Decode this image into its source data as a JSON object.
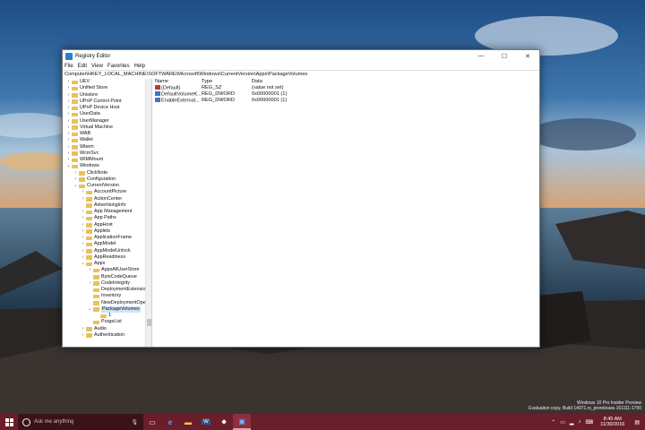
{
  "window": {
    "title": "Registry Editor",
    "minimize": "—",
    "maximize": "☐",
    "close": "✕"
  },
  "menu": [
    "File",
    "Edit",
    "View",
    "Favorites",
    "Help"
  ],
  "address": "Computer\\HKEY_LOCAL_MACHINE\\SOFTWARE\\Microsoft\\Windows\\CurrentVersion\\Appx\\PackageVolumes",
  "tree": [
    {
      "label": "UEV",
      "depth": 0,
      "chevron": ">"
    },
    {
      "label": "Unified Store",
      "depth": 0,
      "chevron": ">"
    },
    {
      "label": "Unistore",
      "depth": 0,
      "chevron": ">"
    },
    {
      "label": "UPnP Control Point",
      "depth": 0,
      "chevron": ">"
    },
    {
      "label": "UPnP Device Host",
      "depth": 0,
      "chevron": ">"
    },
    {
      "label": "UserData",
      "depth": 0,
      "chevron": ">"
    },
    {
      "label": "UserManager",
      "depth": 0,
      "chevron": ">"
    },
    {
      "label": "Virtual Machine",
      "depth": 0,
      "chevron": ">"
    },
    {
      "label": "WAB",
      "depth": 0,
      "chevron": ">"
    },
    {
      "label": "Wallet",
      "depth": 0,
      "chevron": ">"
    },
    {
      "label": "Wbem",
      "depth": 0,
      "chevron": ">"
    },
    {
      "label": "WcmSvc",
      "depth": 0,
      "chevron": ">"
    },
    {
      "label": "WIMMount",
      "depth": 0,
      "chevron": ">"
    },
    {
      "label": "Windows",
      "depth": 0,
      "chevron": "v"
    },
    {
      "label": "ClickNote",
      "depth": 1,
      "chevron": ">"
    },
    {
      "label": "Configuration",
      "depth": 1,
      "chevron": ">"
    },
    {
      "label": "CurrentVersion",
      "depth": 1,
      "chevron": "v"
    },
    {
      "label": "AccountPicture",
      "depth": 2,
      "chevron": ">"
    },
    {
      "label": "ActionCenter",
      "depth": 2,
      "chevron": ">"
    },
    {
      "label": "AdvertisingInfo",
      "depth": 2,
      "chevron": ""
    },
    {
      "label": "App Management",
      "depth": 2,
      "chevron": ">"
    },
    {
      "label": "App Paths",
      "depth": 2,
      "chevron": ">"
    },
    {
      "label": "AppHost",
      "depth": 2,
      "chevron": ">"
    },
    {
      "label": "Applets",
      "depth": 2,
      "chevron": ">"
    },
    {
      "label": "ApplicationFrame",
      "depth": 2,
      "chevron": ">"
    },
    {
      "label": "AppModel",
      "depth": 2,
      "chevron": ">"
    },
    {
      "label": "AppModelUnlock",
      "depth": 2,
      "chevron": ">"
    },
    {
      "label": "AppReadiness",
      "depth": 2,
      "chevron": ">"
    },
    {
      "label": "Appx",
      "depth": 2,
      "chevron": "v"
    },
    {
      "label": "AppxAllUserStore",
      "depth": 3,
      "chevron": ">"
    },
    {
      "label": "ByteCodeQueue",
      "depth": 3,
      "chevron": ""
    },
    {
      "label": "CodeIntegrity",
      "depth": 3,
      "chevron": ">"
    },
    {
      "label": "DeploymentExtensio",
      "depth": 3,
      "chevron": ""
    },
    {
      "label": "Inventory",
      "depth": 3,
      "chevron": ""
    },
    {
      "label": "NewDeploymentOpe",
      "depth": 3,
      "chevron": ""
    },
    {
      "label": "PackageVolumes",
      "depth": 3,
      "chevron": "v",
      "selected": true
    },
    {
      "label": "1",
      "depth": 4,
      "chevron": ""
    },
    {
      "label": "PurgeList",
      "depth": 3,
      "chevron": ""
    },
    {
      "label": "Audio",
      "depth": 2,
      "chevron": ">"
    },
    {
      "label": "Authentication",
      "depth": 2,
      "chevron": ">"
    }
  ],
  "list": {
    "headers": {
      "name": "Name",
      "type": "Type",
      "data": "Data"
    },
    "rows": [
      {
        "name": "(Default)",
        "type": "REG_SZ",
        "data": "(value not set)",
        "icon": "string-value-icon"
      },
      {
        "name": "DefaultVolumeK...",
        "type": "REG_DWORD",
        "data": "0x00000001 (1)",
        "icon": "dword-value-icon"
      },
      {
        "name": "EnableExternal...",
        "type": "REG_DWORD",
        "data": "0x00000001 (1)",
        "icon": "dword-value-icon"
      }
    ]
  },
  "watermark": {
    "line1": "Windows 10 Pro Insider Preview",
    "line2": "Evaluation copy. Build 14971.rs_prerelease.161111-1700"
  },
  "taskbar": {
    "search_placeholder": "Ask me anything",
    "time": "8:45 AM",
    "date": "11/30/2016"
  },
  "colors": {
    "taskbar": "#6a1e2a",
    "selection": "#cde3f7",
    "folder": "#e8c25a"
  }
}
